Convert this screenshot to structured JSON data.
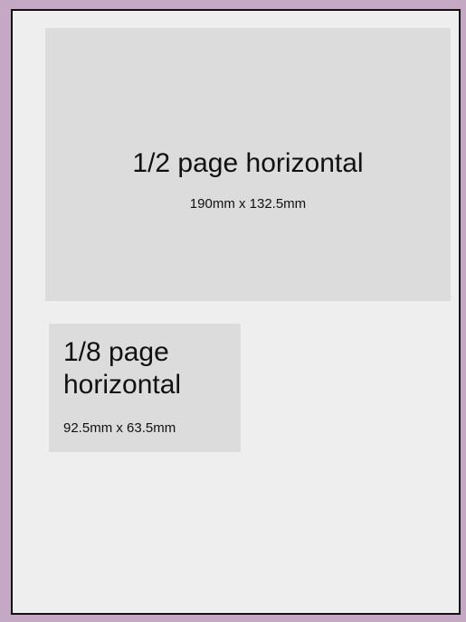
{
  "colors": {
    "background": "#c4a8c4",
    "page": "#eeeeee",
    "page_border": "#111111",
    "ad_block": "#dcdcdc",
    "text": "#111111"
  },
  "ads": {
    "half_horizontal": {
      "label": "1/2 page horizontal",
      "size": "190mm x 132.5mm"
    },
    "eighth_horizontal": {
      "label": "1/8 page horizontal",
      "size": "92.5mm x 63.5mm"
    }
  }
}
